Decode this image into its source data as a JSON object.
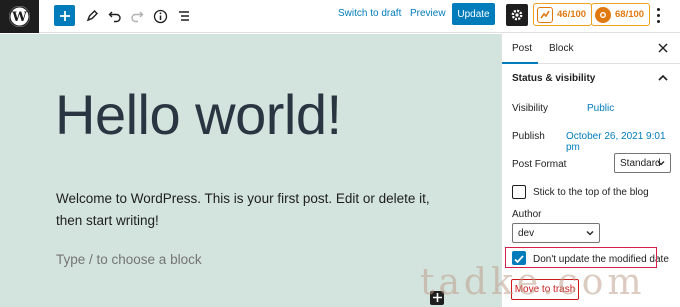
{
  "toolbar": {
    "switch_to_draft": "Switch to draft",
    "preview": "Preview",
    "update": "Update",
    "seo_score": "46/100",
    "readability_score": "68/100"
  },
  "editor": {
    "title": "Hello world!",
    "paragraph": "Welcome to WordPress. This is your first post. Edit or delete it, then start writing!",
    "placeholder": "Type / to choose a block"
  },
  "sidebar": {
    "tabs": [
      "Post",
      "Block"
    ],
    "panel_title": "Status & visibility",
    "visibility_label": "Visibility",
    "visibility_value": "Public",
    "publish_label": "Publish",
    "publish_value": "October 26, 2021 9:01 pm",
    "post_format_label": "Post Format",
    "post_format_value": "Standard",
    "stick_label": "Stick to the top of the blog",
    "author_label": "Author",
    "author_value": "dev",
    "modified_label": "Don't update the modified date",
    "modified_checked": true,
    "trash": "Move to trash"
  },
  "watermark": "tadke.com",
  "colors": {
    "accent": "#007cba",
    "canvas_bg": "#d3e3dd",
    "highlight": "#d4204a",
    "score": "#e07a10"
  }
}
